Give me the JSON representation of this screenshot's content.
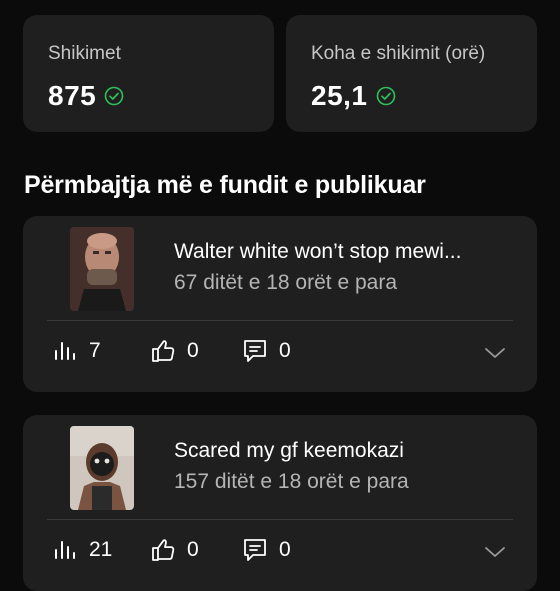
{
  "stats": [
    {
      "label": "Shikimet",
      "value": "875"
    },
    {
      "label": "Koha e shikimit (orë)",
      "value": "25,1"
    }
  ],
  "section_title": "Përmbajtja më e fundit e publikuar",
  "videos": [
    {
      "title": "Walter white won’t stop mewi...",
      "age": "67 ditët e 18 orët e para",
      "views": "7",
      "likes": "0",
      "comments": "0"
    },
    {
      "title": "Scared my gf keemokazi",
      "age": "157 ditët e 18 orët e para",
      "views": "21",
      "likes": "0",
      "comments": "0"
    }
  ],
  "colors": {
    "background": "#0b0b0b",
    "card": "#1f1f1f",
    "check": "#2fbf5b",
    "muted": "#b4b4b4"
  },
  "icons": [
    "check-circle-icon",
    "bar-chart-icon",
    "thumbs-up-icon",
    "comment-icon",
    "chevron-down-icon"
  ]
}
